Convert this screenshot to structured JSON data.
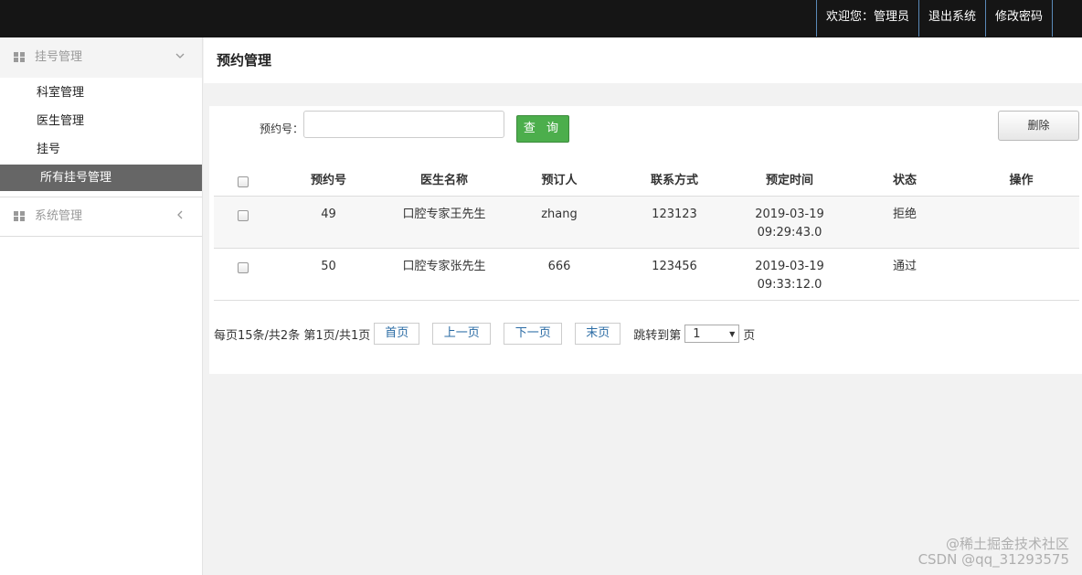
{
  "topnav": {
    "welcome": "欢迎您：管理员",
    "logout": "退出系统",
    "change_password": "修改密码"
  },
  "sidebar": {
    "group1": {
      "label": "挂号管理",
      "icon": "grid-icon",
      "chevron": "chevron-down-icon",
      "items": [
        {
          "label": "科室管理"
        },
        {
          "label": "医生管理"
        },
        {
          "label": "挂号"
        },
        {
          "label": "所有挂号管理",
          "active": true
        }
      ]
    },
    "group2": {
      "label": "系统管理",
      "icon": "grid-icon",
      "chevron": "chevron-left-icon"
    }
  },
  "page": {
    "title": "预约管理"
  },
  "search": {
    "label": "预约号：",
    "value": "",
    "query_label": "查 询",
    "delete_label": "删除"
  },
  "table": {
    "headers": [
      "",
      "预约号",
      "医生名称",
      "预订人",
      "联系方式",
      "预定时间",
      "状态",
      "操作"
    ],
    "rows": [
      {
        "id": "49",
        "doctor": "口腔专家王先生",
        "booker": "zhang",
        "contact": "123123",
        "date": "2019-03-19",
        "time": "09:29:43.0",
        "status": "拒绝",
        "action": ""
      },
      {
        "id": "50",
        "doctor": "口腔专家张先生",
        "booker": "666",
        "contact": "123456",
        "date": "2019-03-19",
        "time": "09:33:12.0",
        "status": "通过",
        "action": ""
      }
    ]
  },
  "pager": {
    "summary": "每页15条/共2条 第1页/共1页",
    "first": "首页",
    "prev": "上一页",
    "next": "下一页",
    "last": "末页",
    "jump_prefix": "跳转到第",
    "current_page": "1",
    "jump_suffix": "页"
  },
  "watermark": {
    "line1": "@稀土掘金技术社区",
    "line2": "CSDN @qq_31293575"
  },
  "colors": {
    "topbar": "#151515",
    "active_menu": "#666666",
    "query_button": "#4cae4c",
    "link": "#2a6ba4"
  }
}
